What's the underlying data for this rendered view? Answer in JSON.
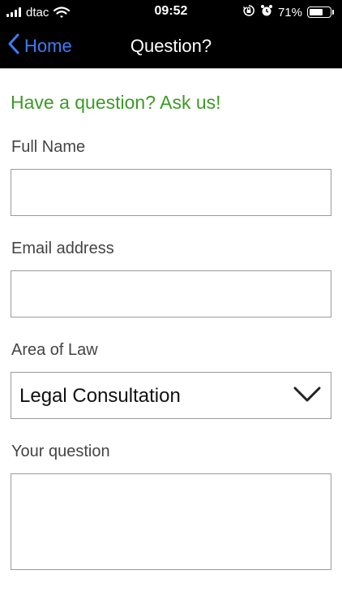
{
  "status_bar": {
    "carrier": "dtac",
    "time": "09:52",
    "battery_percent": "71%",
    "battery_level": 0.71,
    "icons": [
      "signal-icon",
      "wifi-icon",
      "orientation-lock-icon",
      "alarm-icon",
      "battery-icon"
    ]
  },
  "nav": {
    "back_label": "Home",
    "title": "Question?",
    "accent_color": "#3b7df7"
  },
  "form": {
    "heading": "Have a question? Ask us!",
    "heading_color": "#3b9b24",
    "full_name": {
      "label": "Full Name",
      "value": "",
      "placeholder": ""
    },
    "email": {
      "label": "Email address",
      "value": "",
      "placeholder": ""
    },
    "area_of_law": {
      "label": "Area of Law",
      "selected": "Legal Consultation"
    },
    "question": {
      "label": "Your question",
      "value": "",
      "placeholder": ""
    }
  }
}
